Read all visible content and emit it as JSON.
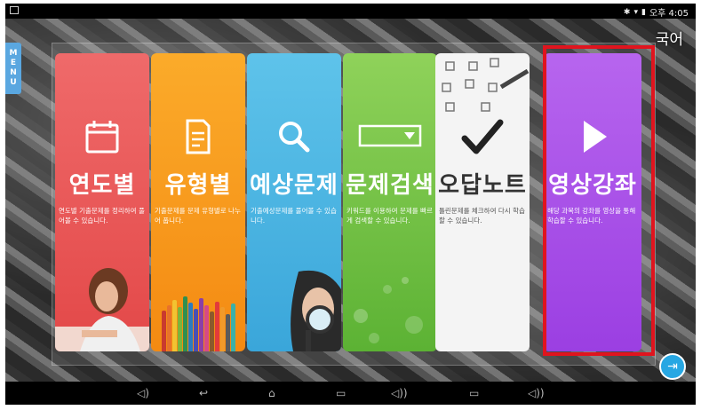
{
  "statusbar": {
    "time": "오후 4:05"
  },
  "language_label": "국어",
  "menu_tab": {
    "letters": [
      "M",
      "E",
      "N",
      "U"
    ]
  },
  "cards": [
    {
      "title": "연도별",
      "desc": "연도별 기출문제를 정리하여 풀어볼 수 있습니다.",
      "icon": "calendar-icon",
      "color": "#e34848"
    },
    {
      "title": "유형별",
      "desc": "기출문제를 문제 유형별로 나누어 풉니다.",
      "icon": "document-icon",
      "color": "#f48a12"
    },
    {
      "title": "예상문제",
      "desc": "기출예상문제를 풀어볼 수 있습니다.",
      "icon": "search-icon",
      "color": "#3aa6da"
    },
    {
      "title": "문제검색",
      "desc": "키워드를 이용하여 문제를 빠르게 검색할 수 있습니다.",
      "icon": "dropdown-icon",
      "color": "#5cb234"
    },
    {
      "title": "오답노트",
      "desc": "틀린문제를 체크하여 다시 학습할 수 있습니다.",
      "icon": "checkmark-icon",
      "color": "#f4f4f4"
    },
    {
      "title": "영상강좌",
      "desc": "해당 과목의 강좌를 영상을 통해 학습할 수 있습니다.",
      "icon": "play-icon",
      "color": "#9b3fe2"
    }
  ],
  "highlight_color": "#e0141e",
  "navbar": {
    "icons": [
      "volume-down-icon",
      "back-icon",
      "home-icon",
      "recents-icon",
      "volume-up-icon",
      "recents-icon",
      "volume-up-icon"
    ]
  },
  "corner_button": {
    "icon": "exit-icon"
  }
}
